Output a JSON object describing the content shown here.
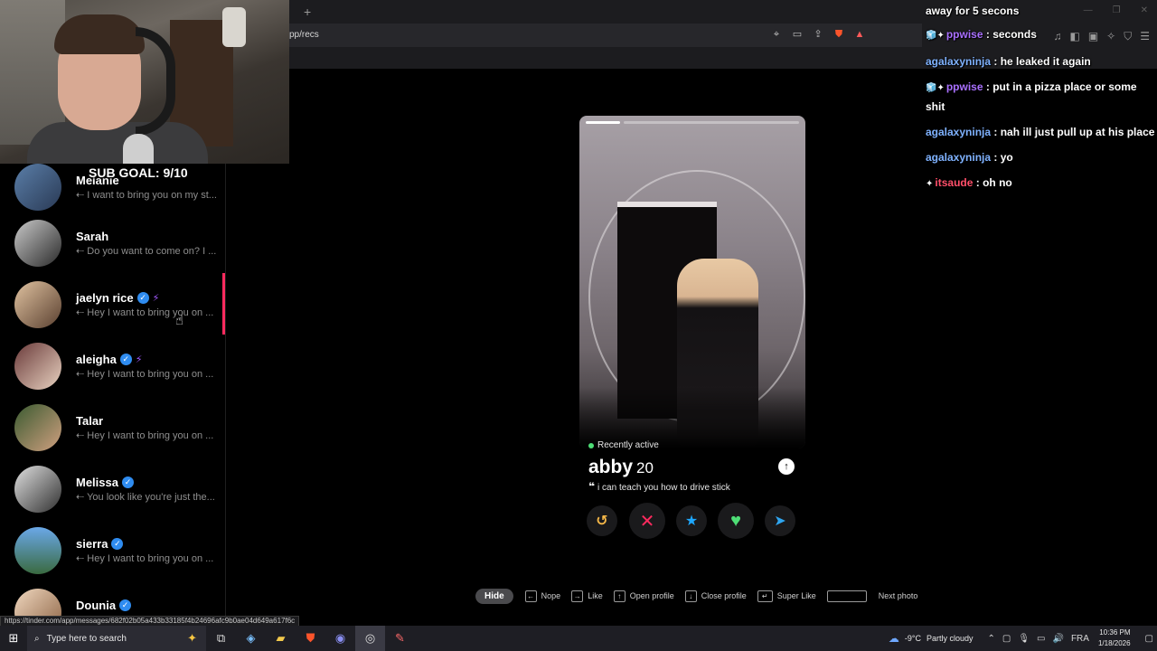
{
  "browser": {
    "new_tab": "+",
    "url_fragment": "pp/recs",
    "status_url": "https://tinder.com/app/messages/682f02b05a433b33185f4b24696afc9b0ae04d649a617f6c",
    "window_controls": [
      "—",
      "❐",
      "✕"
    ]
  },
  "overlay": {
    "sub_goal": "SUB GOAL: 9/10"
  },
  "messages": [
    {
      "name": "Melanie",
      "preview": "I want to bring you on my st...",
      "verified": false,
      "boost": false
    },
    {
      "name": "Sarah",
      "preview": "Do you want to come on? I ...",
      "verified": false,
      "boost": false
    },
    {
      "name": "jaelyn rice",
      "preview": "Hey I want to bring you on ...",
      "verified": true,
      "boost": true
    },
    {
      "name": "aleigha",
      "preview": "Hey I want to bring you on ...",
      "verified": true,
      "boost": true
    },
    {
      "name": "Talar",
      "preview": "Hey I want to bring you on ...",
      "verified": false,
      "boost": false
    },
    {
      "name": "Melissa",
      "preview": "You look like you're just the...",
      "verified": true,
      "boost": false
    },
    {
      "name": "sierra",
      "preview": "Hey I want to bring you on ...",
      "verified": true,
      "boost": false
    },
    {
      "name": "Dounia",
      "preview": "",
      "verified": true,
      "boost": false
    }
  ],
  "profile": {
    "status": "Recently active",
    "name": "abby",
    "age": "20",
    "bio": "i can teach you how to drive stick",
    "photo_index": 1,
    "photo_count": 2
  },
  "actions": {
    "rewind": "↺",
    "nope": "✕",
    "super_like": "★",
    "like": "♥",
    "boost": "➤"
  },
  "hints": {
    "hide": "Hide",
    "items": [
      {
        "key": "←",
        "label": "Nope"
      },
      {
        "key": "→",
        "label": "Like"
      },
      {
        "key": "↑",
        "label": "Open profile"
      },
      {
        "key": "↓",
        "label": "Close profile"
      },
      {
        "key": "↵",
        "label": "Super Like"
      },
      {
        "key": "",
        "label": "Next photo"
      }
    ]
  },
  "chat": {
    "headline": "away for 5 secons",
    "lines": [
      {
        "user": "ppwise",
        "text": ": seconds",
        "color": "#a970ff",
        "badges": "🧊✦"
      },
      {
        "user": "agalaxyninja",
        "text": ": he leaked it again",
        "color": "#7fb2ff",
        "badges": ""
      },
      {
        "user": "ppwise",
        "text": ": put in a pizza place or some shit",
        "color": "#a970ff",
        "badges": "🧊✦"
      },
      {
        "user": "agalaxyninja",
        "text": ": nah ill just pull up at his place",
        "color": "#7fb2ff",
        "badges": ""
      },
      {
        "user": "agalaxyninja",
        "text": ": yo",
        "color": "#7fb2ff",
        "badges": ""
      },
      {
        "user": "itsaude",
        "text": ": oh no",
        "color": "#ff4f6a",
        "badges": "✦"
      }
    ]
  },
  "taskbar": {
    "search_placeholder": "Type here to search",
    "weather": "-9°C",
    "weather_desc": "Partly cloudy",
    "language": "FRA",
    "time": "10:36 PM",
    "date": "1/18/2026"
  },
  "colors": {
    "tinder_accent": "#fd2a5e",
    "verified": "#2f8cf0",
    "active_green": "#4ede76"
  }
}
